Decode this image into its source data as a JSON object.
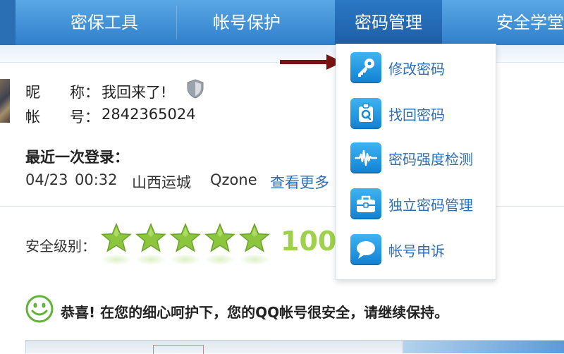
{
  "nav": {
    "items": [
      {
        "label": "密保工具"
      },
      {
        "label": "帐号保护"
      },
      {
        "label": "密码管理",
        "active": true
      },
      {
        "label": "安全学堂"
      }
    ]
  },
  "profile": {
    "nickname_label": "昵　　称：",
    "nickname_value": "我回来了!",
    "account_label": "帐　　号：",
    "account_value": "2842365024"
  },
  "last_login": {
    "title": "最近一次登录：",
    "date": "04/23",
    "time": "00:32",
    "location": "山西运城",
    "source": "Qzone",
    "more_link": "查看更多"
  },
  "security": {
    "label": "安全级别：",
    "stars_filled": 5,
    "stars_total": 5,
    "score": "100"
  },
  "message": {
    "text": "恭喜! 在您的细心呵护下，您的QQ帐号很安全，请继续保持。"
  },
  "dropdown": {
    "items": [
      {
        "label": "修改密码",
        "icon": "key-icon"
      },
      {
        "label": "找回密码",
        "icon": "search-q-icon"
      },
      {
        "label": "密码强度检测",
        "icon": "waveform-icon"
      },
      {
        "label": "独立密码管理",
        "icon": "briefcase-icon"
      },
      {
        "label": "帐号申诉",
        "icon": "speech-bubble-icon"
      }
    ]
  },
  "colors": {
    "nav_top": "#5aa7e4",
    "nav_bottom": "#2f7fcb",
    "link": "#2a6fb8",
    "score": "#9fd14a",
    "star": "#8cc63f",
    "arrow": "#7a1414"
  }
}
